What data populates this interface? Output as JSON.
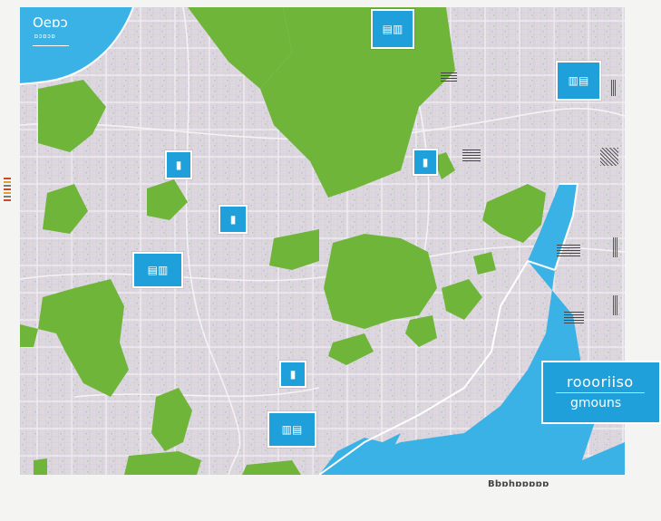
{
  "map": {
    "corner_title": "Oeɒɔ",
    "corner_subtitle": "ɒɔɒɔɒ",
    "legend_title": "roooriiso",
    "legend_subtitle": "gmouns",
    "scale_label": "Bbɒhɒɒɒɒɒ"
  },
  "markers": [
    {
      "id": "m1",
      "label": "▤▥"
    },
    {
      "id": "m2",
      "label": "▥▤"
    },
    {
      "id": "m3",
      "label": "▮"
    },
    {
      "id": "m4",
      "label": "▮"
    },
    {
      "id": "m5",
      "label": "▮"
    },
    {
      "id": "m6",
      "label": "▤▥"
    },
    {
      "id": "m7",
      "label": "▮"
    },
    {
      "id": "m8",
      "label": "▥▤"
    }
  ],
  "colors": {
    "water": "#3bb2e6",
    "park": "#6fb53a",
    "urban": "#dcd7de",
    "marker": "#1fa0db"
  }
}
